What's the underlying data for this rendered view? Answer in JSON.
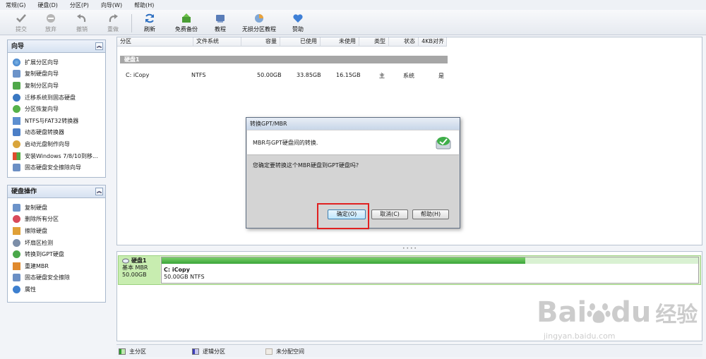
{
  "menu": [
    "常规(G)",
    "硬盘(D)",
    "分区(P)",
    "向导(W)",
    "帮助(H)"
  ],
  "toolbar": {
    "submit": "提交",
    "discard": "放弃",
    "undo": "撤销",
    "redo": "重做",
    "refresh": "刷新",
    "free_backup": "免费备份",
    "tutorial": "教程",
    "lossless_tutorial": "无损分区教程",
    "donate": "赞助"
  },
  "wizard": {
    "title": "向导",
    "items": [
      "扩展分区向导",
      "复制硬盘向导",
      "复制分区向导",
      "迁移系统到固态硬盘",
      "分区恢复向导",
      "NTFS与FAT32转换器",
      "动态硬盘转换器",
      "启动光盘制作向导",
      "安装Windows 7/8/10到移...",
      "固态硬盘安全擦除向导"
    ]
  },
  "disk_ops": {
    "title": "硬盘操作",
    "items": [
      "复制硬盘",
      "删除所有分区",
      "擦除硬盘",
      "坏扇区检测",
      "转换到GPT硬盘",
      "重建MBR",
      "固态硬盘安全擦除",
      "属性"
    ]
  },
  "columns": [
    "分区",
    "文件系统",
    "容量",
    "已使用",
    "未使用",
    "类型",
    "状态",
    "4KB对齐"
  ],
  "disk_header": "硬盘1",
  "row": {
    "partition": "C: iCopy",
    "fs": "NTFS",
    "capacity": "50.00GB",
    "used": "33.85GB",
    "free": "16.15GB",
    "type": "主",
    "status": "系统",
    "aligned": "是"
  },
  "disk_map": {
    "name": "硬盘1",
    "kind": "基本 MBR",
    "size": "50.00GB",
    "part_name": "C: iCopy",
    "part_info": "50.00GB NTFS",
    "used_fraction": 0.677
  },
  "legend": {
    "primary": "主分区",
    "logical": "逻辑分区",
    "unallocated": "未分配空间"
  },
  "dialog": {
    "title": "转换GPT/MBR",
    "desc": "MBR与GPT硬盘间的转换.",
    "question": "您确定要转换这个MBR硬盘到GPT硬盘吗?",
    "ok": "确定(O)",
    "cancel": "取消(C)",
    "help": "帮助(H)"
  },
  "watermark": {
    "brand": "Bai",
    "brand2": "du",
    "cn": "经验",
    "url": "jingyan.baidu.com"
  },
  "colors": {
    "accent": "#3aa53a",
    "highlight": "#e02020",
    "panel_border": "#a9b8cc"
  }
}
